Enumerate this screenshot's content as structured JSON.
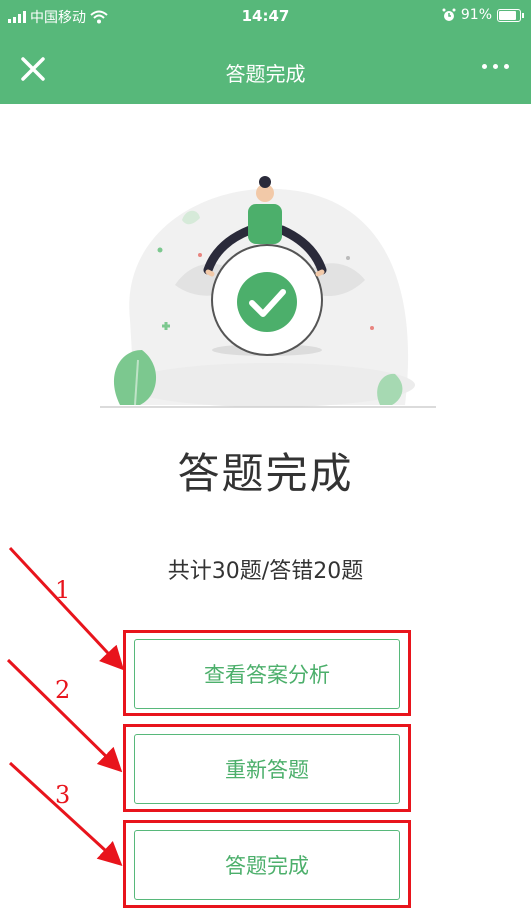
{
  "status_bar": {
    "carrier": "中国移动",
    "time": "14:47",
    "battery": "91%"
  },
  "nav": {
    "title": "答题完成"
  },
  "result": {
    "heading": "答题完成",
    "summary": "共计30题/答错20题"
  },
  "buttons": [
    {
      "label": "查看答案分析"
    },
    {
      "label": "重新答题"
    },
    {
      "label": "答题完成"
    }
  ],
  "annotations": [
    "1",
    "2",
    "3"
  ],
  "colors": {
    "primary": "#57b87a",
    "annotation": "#e8141c"
  }
}
